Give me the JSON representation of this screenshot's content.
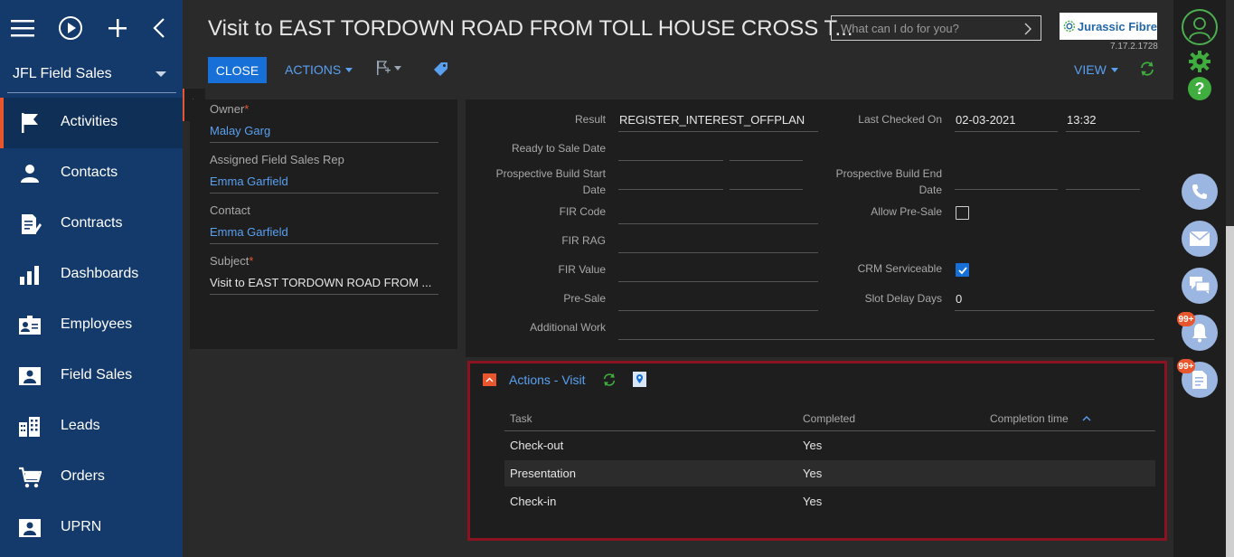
{
  "app": {
    "workspace": "JFL Field Sales",
    "title": "Visit to EAST TORDOWN ROAD FROM TOLL HOUSE CROSS T...",
    "search_placeholder": "What can I do for you?",
    "logo_text": "Jurassic Fibre",
    "version": "7.17.2.1728"
  },
  "toolbar": {
    "close_label": "CLOSE",
    "actions_label": "ACTIONS",
    "view_label": "VIEW"
  },
  "sidebar": {
    "items": [
      {
        "label": "Activities",
        "icon": "flag-icon"
      },
      {
        "label": "Contacts",
        "icon": "person-icon"
      },
      {
        "label": "Contracts",
        "icon": "document-edit-icon"
      },
      {
        "label": "Dashboards",
        "icon": "bar-chart-icon"
      },
      {
        "label": "Employees",
        "icon": "id-card-icon"
      },
      {
        "label": "Field Sales",
        "icon": "person-board-icon"
      },
      {
        "label": "Leads",
        "icon": "buildings-icon"
      },
      {
        "label": "Orders",
        "icon": "cart-icon"
      },
      {
        "label": "UPRN",
        "icon": "person-board-icon"
      }
    ]
  },
  "left_panel": {
    "owner_label": "Owner",
    "owner_value": "Malay Garg",
    "rep_label": "Assigned Field Sales Rep",
    "rep_value": "Emma Garfield",
    "contact_label": "Contact",
    "contact_value": "Emma Garfield",
    "subject_label": "Subject",
    "subject_value": "Visit to EAST TORDOWN ROAD FROM ..."
  },
  "form": {
    "result_label": "Result",
    "result_value": "REGISTER_INTEREST_OFFPLAN",
    "ready_label": "Ready to Sale Date",
    "pbs_label_1": "Prospective Build Start",
    "pbs_label_2": "Date",
    "fir_code_label": "FIR Code",
    "fir_rag_label": "FIR RAG",
    "fir_value_label": "FIR Value",
    "presale_label": "Pre-Sale",
    "additional_label": "Additional Work",
    "last_checked_label": "Last Checked On",
    "last_checked_date": "02-03-2021",
    "last_checked_time": "13:32",
    "pbe_label_1": "Prospective Build End",
    "pbe_label_2": "Date",
    "allow_presale_label": "Allow Pre-Sale",
    "allow_presale_checked": false,
    "crm_label": "CRM Serviceable",
    "crm_checked": true,
    "slot_label": "Slot Delay Days",
    "slot_value": "0"
  },
  "actions_section": {
    "title": "Actions - Visit",
    "columns": [
      "Task",
      "Completed",
      "Completion time"
    ],
    "rows": [
      {
        "task": "Check-out",
        "completed": "Yes"
      },
      {
        "task": "Presentation",
        "completed": "Yes"
      },
      {
        "task": "Check-in",
        "completed": "Yes"
      }
    ]
  },
  "rail": {
    "notifications_badge": "99+",
    "tasks_badge": "99+"
  },
  "colors": {
    "sidebar": "#143a6b",
    "accent": "#e9552c",
    "primary": "#1670d8",
    "link": "#5aa0f0",
    "success": "#3fae3f",
    "highlight_border": "#8b1220"
  }
}
